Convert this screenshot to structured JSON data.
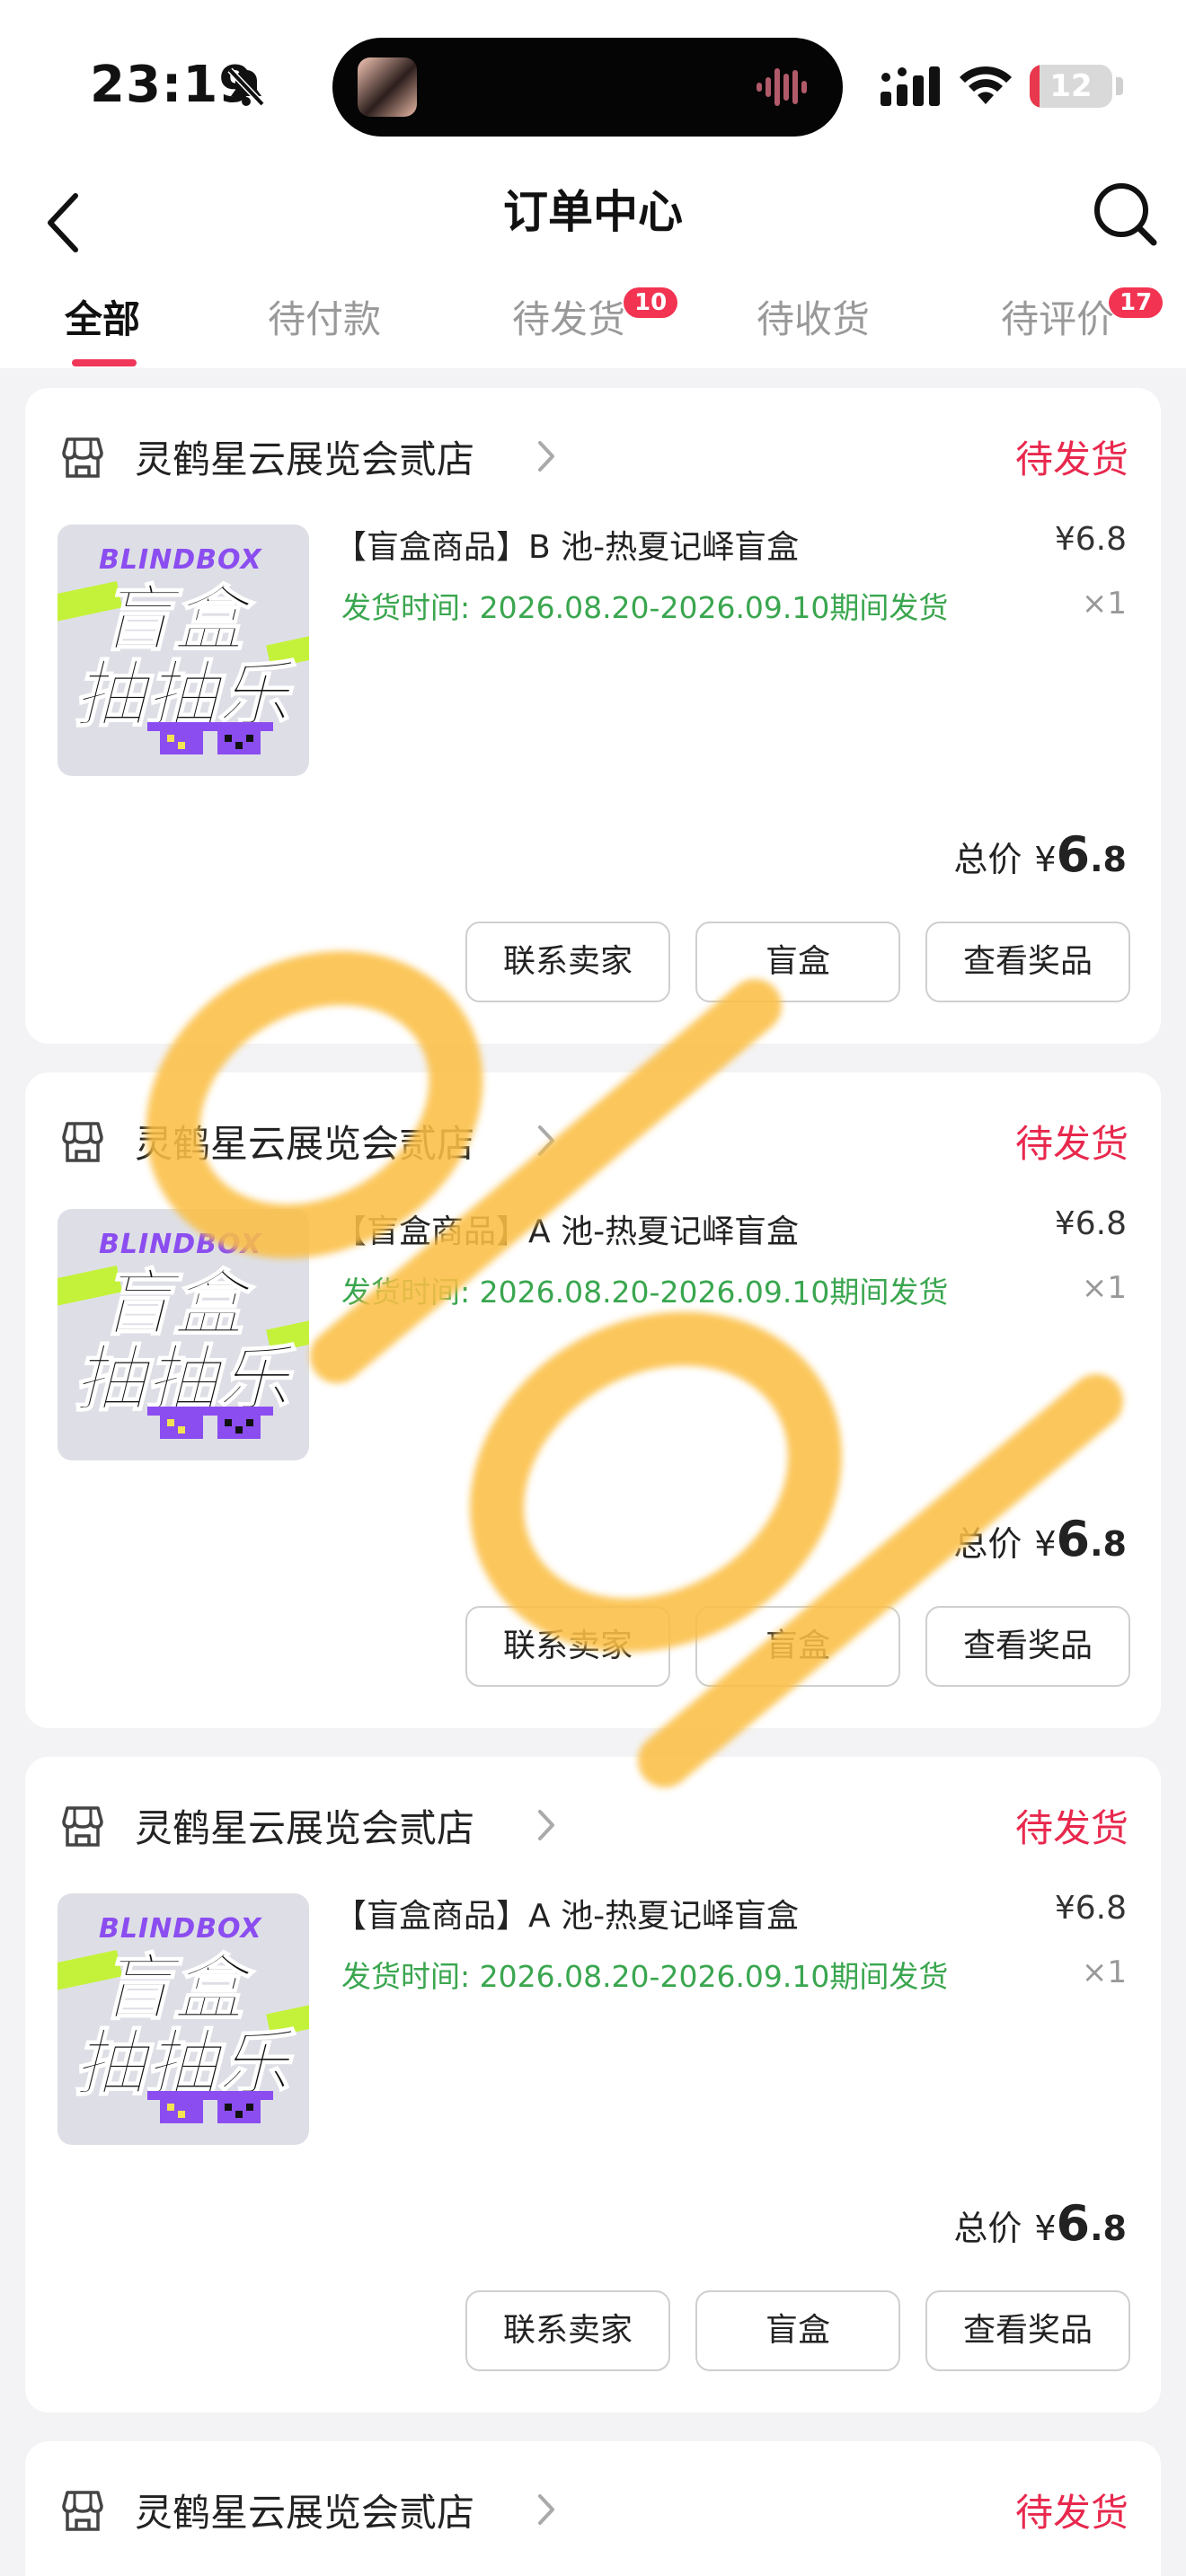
{
  "status_bar": {
    "time": "23:19",
    "battery": "12",
    "battery_level": 0.12,
    "icons": [
      "bell-muted-icon",
      "waveform-icon",
      "signal-icon",
      "wifi-icon",
      "battery-icon"
    ]
  },
  "header": {
    "title": "订单中心",
    "icons": [
      "back-icon",
      "search-icon"
    ]
  },
  "tabs": [
    {
      "label": "全部",
      "active": true
    },
    {
      "label": "待付款"
    },
    {
      "label": "待发货",
      "badge": "10"
    },
    {
      "label": "待收货"
    },
    {
      "label": "待评价",
      "badge": "17"
    }
  ],
  "orders": [
    {
      "shop": "灵鹤星云展览会贰店",
      "status": "待发货",
      "image": {
        "line1": "BLINDBOX",
        "line2": "盲盒",
        "line3": "抽抽乐"
      },
      "title": "【盲盒商品】B 池-热夏记峄盲盒",
      "ship_time": "发货时间: 2026.08.20-2026.09.10期间发货",
      "price": "¥6.8",
      "quantity": "×1",
      "total_label": "总价",
      "total_symbol": "¥",
      "total_int": "6",
      "total_dec": ".8",
      "buttons": [
        "联系卖家",
        "盲盒",
        "查看奖品"
      ]
    },
    {
      "shop": "灵鹤星云展览会贰店",
      "status": "待发货",
      "image": {
        "line1": "BLINDBOX",
        "line2": "盲盒",
        "line3": "抽抽乐"
      },
      "title": "【盲盒商品】A 池-热夏记峄盲盒",
      "ship_time": "发货时间: 2026.08.20-2026.09.10期间发货",
      "price": "¥6.8",
      "quantity": "×1",
      "total_label": "总价",
      "total_symbol": "¥",
      "total_int": "6",
      "total_dec": ".8",
      "buttons": [
        "联系卖家",
        "盲盒",
        "查看奖品"
      ]
    },
    {
      "shop": "灵鹤星云展览会贰店",
      "status": "待发货",
      "image": {
        "line1": "BLINDBOX",
        "line2": "盲盒",
        "line3": "抽抽乐"
      },
      "title": "【盲盒商品】A 池-热夏记峄盲盒",
      "ship_time": "发货时间: 2026.08.20-2026.09.10期间发货",
      "price": "¥6.8",
      "quantity": "×1",
      "total_label": "总价",
      "total_symbol": "¥",
      "total_int": "6",
      "total_dec": ".8",
      "buttons": [
        "联系卖家",
        "盲盒",
        "查看奖品"
      ]
    },
    {
      "shop": "灵鹤星云展览会贰店",
      "status": "待发货"
    }
  ],
  "colors": {
    "accent": "#f03659",
    "status": "#e8284d",
    "ship_time": "#3aa64f",
    "background": "#f3f3f5",
    "watermark": "#fbbf45"
  }
}
